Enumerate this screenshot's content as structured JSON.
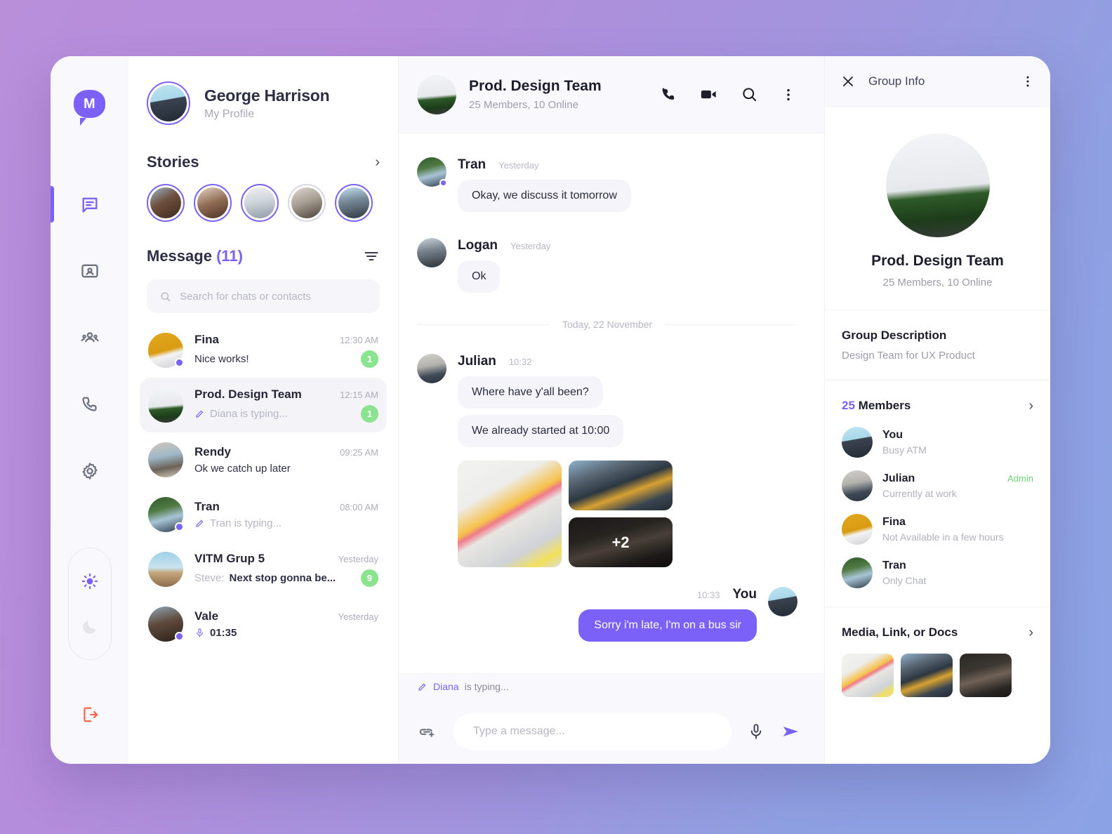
{
  "rail": {
    "logo_letter": "M",
    "items": [
      {
        "name": "chat",
        "label": "Chats",
        "active": true
      },
      {
        "name": "contacts",
        "label": "Contacts",
        "active": false
      },
      {
        "name": "groups",
        "label": "Groups",
        "active": false
      },
      {
        "name": "calls",
        "label": "Calls",
        "active": false
      },
      {
        "name": "settings",
        "label": "Settings",
        "active": false
      }
    ],
    "theme": {
      "light_label": "Light mode",
      "dark_label": "Dark mode",
      "selected": "light"
    },
    "logout_label": "Log out"
  },
  "sidebar": {
    "profile": {
      "name": "George Harrison",
      "subtitle": "My Profile"
    },
    "stories": {
      "title": "Stories",
      "items": [
        {
          "name": "story-1",
          "seen": false
        },
        {
          "name": "story-2",
          "seen": false
        },
        {
          "name": "story-3",
          "seen": false
        },
        {
          "name": "story-4",
          "seen": true
        },
        {
          "name": "story-5",
          "seen": false
        }
      ]
    },
    "message_header": {
      "title": "Message",
      "count": "(11)"
    },
    "search": {
      "placeholder": "Search for chats or contacts",
      "value": ""
    },
    "chats": [
      {
        "name": "Fina",
        "time": "12:30 AM",
        "preview": "Nice works!",
        "prefix": "",
        "badge": "1",
        "online": true,
        "active": false,
        "typing": false,
        "voice": false,
        "muted": false,
        "photo": "ph-fina"
      },
      {
        "name": "Prod. Design Team",
        "time": "12:15 AM",
        "preview": "Diana is typing...",
        "prefix": "",
        "badge": "1",
        "online": false,
        "active": true,
        "typing": true,
        "voice": false,
        "muted": true,
        "photo": "ph-team"
      },
      {
        "name": "Rendy",
        "time": "09:25 AM",
        "preview": "Ok we catch up later",
        "prefix": "",
        "badge": "",
        "online": false,
        "active": false,
        "typing": false,
        "voice": false,
        "muted": false,
        "photo": "ph-rendy"
      },
      {
        "name": "Tran",
        "time": "08:00 AM",
        "preview": "Tran is typing...",
        "prefix": "",
        "badge": "",
        "online": true,
        "active": false,
        "typing": true,
        "voice": false,
        "muted": true,
        "photo": "ph-tran"
      },
      {
        "name": "VITM Grup 5",
        "time": "Yesterday",
        "preview": "Next stop gonna be...",
        "prefix": "Steve:",
        "badge": "9",
        "online": false,
        "active": false,
        "typing": false,
        "voice": false,
        "muted": false,
        "photo": "ph-vitm"
      },
      {
        "name": "Vale",
        "time": "Yesterday",
        "preview": "01:35",
        "prefix": "",
        "badge": "",
        "online": true,
        "active": false,
        "typing": false,
        "voice": true,
        "muted": false,
        "photo": "ph-vale"
      }
    ]
  },
  "chat": {
    "header": {
      "title": "Prod. Design Team",
      "subtitle": "25 Members, 10 Online",
      "actions": [
        "call-icon",
        "video-icon",
        "search-icon",
        "more-icon"
      ]
    },
    "date_divider": "Today, 22 November",
    "messages": [
      {
        "sender": "Tran",
        "time": "Yesterday",
        "online": true,
        "photo": "ph-tran",
        "outgoing": false,
        "bubbles": [
          "Okay, we discuss it tomorrow"
        ],
        "photos": []
      },
      {
        "sender": "Logan",
        "time": "Yesterday",
        "online": false,
        "photo": "ph-logan",
        "outgoing": false,
        "bubbles": [
          "Ok"
        ],
        "photos": []
      },
      {
        "sender": "Julian",
        "time": "10:32",
        "online": false,
        "photo": "ph-julian",
        "outgoing": false,
        "bubbles": [
          "Where have y'all been?",
          "We already started at 10:00"
        ],
        "photos": [
          {
            "name": "photo-1",
            "art": "ph-img1",
            "overlay": ""
          },
          {
            "name": "photo-2",
            "art": "ph-img2",
            "overlay": ""
          },
          {
            "name": "photo-3",
            "art": "ph-img3",
            "overlay": "+2"
          }
        ]
      },
      {
        "sender": "You",
        "time": "10:33",
        "online": false,
        "photo": "ph-george",
        "outgoing": true,
        "bubbles": [
          "Sorry i'm late, I'm on a bus sir"
        ],
        "photos": []
      }
    ],
    "typing_indicator": {
      "who": "Diana",
      "text": " is typing..."
    },
    "composer": {
      "placeholder": "Type a message...",
      "value": ""
    }
  },
  "group_info": {
    "header_title": "Group Info",
    "group_name": "Prod. Design Team",
    "group_meta": "25 Members, 10 Online",
    "description_title": "Group Description",
    "description_text": "Design Team for UX Product",
    "members_count": "25",
    "members_label": "Members",
    "members": [
      {
        "name": "You",
        "status": "Busy ATM",
        "tag": "",
        "photo": "ph-george"
      },
      {
        "name": "Julian",
        "status": "Currently at work",
        "tag": "Admin",
        "photo": "ph-julian"
      },
      {
        "name": "Fina",
        "status": "Not Available in a few hours",
        "tag": "",
        "photo": "ph-fina"
      },
      {
        "name": "Tran",
        "status": "Only Chat",
        "tag": "",
        "photo": "ph-tran"
      }
    ],
    "media_title": "Media, Link, or Docs",
    "media": [
      {
        "name": "media-thumb-1",
        "art": "ph-img1"
      },
      {
        "name": "media-thumb-2",
        "art": "ph-img2"
      },
      {
        "name": "media-thumb-3",
        "art": "ph-img3"
      }
    ]
  },
  "colors": {
    "accent": "#7b61f8",
    "badge_green": "#8ae38e",
    "admin_green": "#6ed47a",
    "logout_red": "#f4694f",
    "bg_gradient_from": "#b98fda",
    "bg_gradient_to": "#8ba3e4"
  }
}
